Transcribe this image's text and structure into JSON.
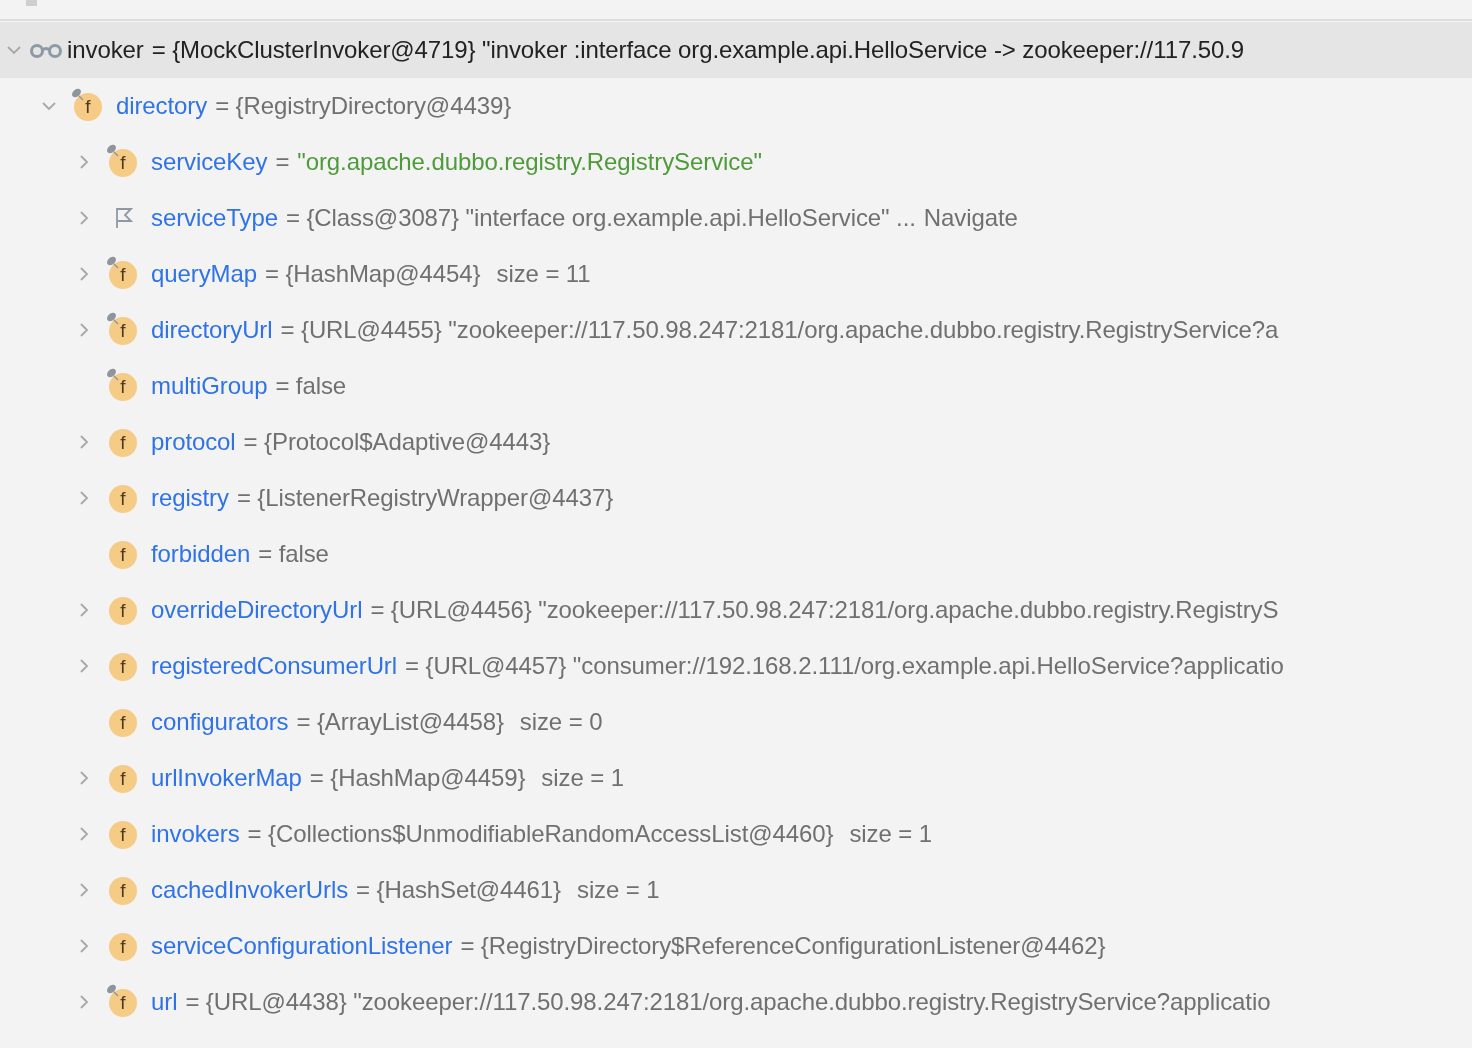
{
  "tree": [
    {
      "kind": "watch",
      "name": "invoker",
      "value": "= {MockClusterInvoker@4719} \"invoker :interface org.example.api.HelloService -> zookeeper://117.50.9",
      "expanded": true,
      "selected": true,
      "children": [
        {
          "kind": "field",
          "badge": "f",
          "final": true,
          "name": "directory",
          "value": "= {RegistryDirectory@4439}",
          "expanded": true,
          "selected": false,
          "children": [
            {
              "kind": "field",
              "badge": "f",
              "final": true,
              "name": "serviceKey",
              "value": "=",
              "string": "\"org.apache.dubbo.registry.RegistryService\"",
              "expanded": false,
              "selected": false
            },
            {
              "kind": "flag",
              "name": "serviceType",
              "value": "= {Class@3087} \"interface org.example.api.HelloService\" ...",
              "link": "Navigate",
              "expanded": false,
              "selected": false
            },
            {
              "kind": "field",
              "badge": "f",
              "final": true,
              "name": "queryMap",
              "value": "= {HashMap@4454}",
              "extra": "size = 11",
              "expanded": false,
              "selected": false
            },
            {
              "kind": "field",
              "badge": "f",
              "final": true,
              "name": "directoryUrl",
              "value": "= {URL@4455} \"zookeeper://117.50.98.247:2181/org.apache.dubbo.registry.RegistryService?a",
              "expanded": false,
              "selected": false
            },
            {
              "kind": "field",
              "badge": "f",
              "final": true,
              "name": "multiGroup",
              "value": "= false",
              "selected": false
            },
            {
              "kind": "field",
              "badge": "f",
              "final": false,
              "name": "protocol",
              "value": "= {Protocol$Adaptive@4443}",
              "expanded": false,
              "selected": false
            },
            {
              "kind": "field",
              "badge": "f",
              "final": false,
              "name": "registry",
              "value": "= {ListenerRegistryWrapper@4437}",
              "expanded": false,
              "selected": false
            },
            {
              "kind": "field",
              "badge": "f",
              "final": false,
              "name": "forbidden",
              "value": "= false",
              "selected": false
            },
            {
              "kind": "field",
              "badge": "f",
              "final": false,
              "name": "overrideDirectoryUrl",
              "value": "= {URL@4456} \"zookeeper://117.50.98.247:2181/org.apache.dubbo.registry.RegistryS",
              "expanded": false,
              "selected": false
            },
            {
              "kind": "field",
              "badge": "f",
              "final": false,
              "name": "registeredConsumerUrl",
              "value": "= {URL@4457} \"consumer://192.168.2.111/org.example.api.HelloService?applicatio",
              "expanded": false,
              "selected": false
            },
            {
              "kind": "field",
              "badge": "f",
              "final": false,
              "name": "configurators",
              "value": "= {ArrayList@4458}",
              "extra": "size = 0",
              "selected": false
            },
            {
              "kind": "field",
              "badge": "f",
              "final": false,
              "name": "urlInvokerMap",
              "value": "= {HashMap@4459}",
              "extra": "size = 1",
              "expanded": false,
              "selected": false
            },
            {
              "kind": "field",
              "badge": "f",
              "final": false,
              "name": "invokers",
              "value": "= {Collections$UnmodifiableRandomAccessList@4460}",
              "extra": "size = 1",
              "expanded": false,
              "selected": false
            },
            {
              "kind": "field",
              "badge": "f",
              "final": false,
              "name": "cachedInvokerUrls",
              "value": "= {HashSet@4461}",
              "extra": "size = 1",
              "expanded": false,
              "selected": false
            },
            {
              "kind": "field",
              "badge": "f",
              "final": false,
              "name": "serviceConfigurationListener",
              "value": "= {RegistryDirectory$ReferenceConfigurationListener@4462}",
              "expanded": false,
              "selected": false
            },
            {
              "kind": "field",
              "badge": "f",
              "final": true,
              "name": "url",
              "value": "= {URL@4438} \"zookeeper://117.50.98.247:2181/org.apache.dubbo.registry.RegistryService?applicatio",
              "expanded": false,
              "selected": false
            }
          ]
        }
      ]
    }
  ]
}
